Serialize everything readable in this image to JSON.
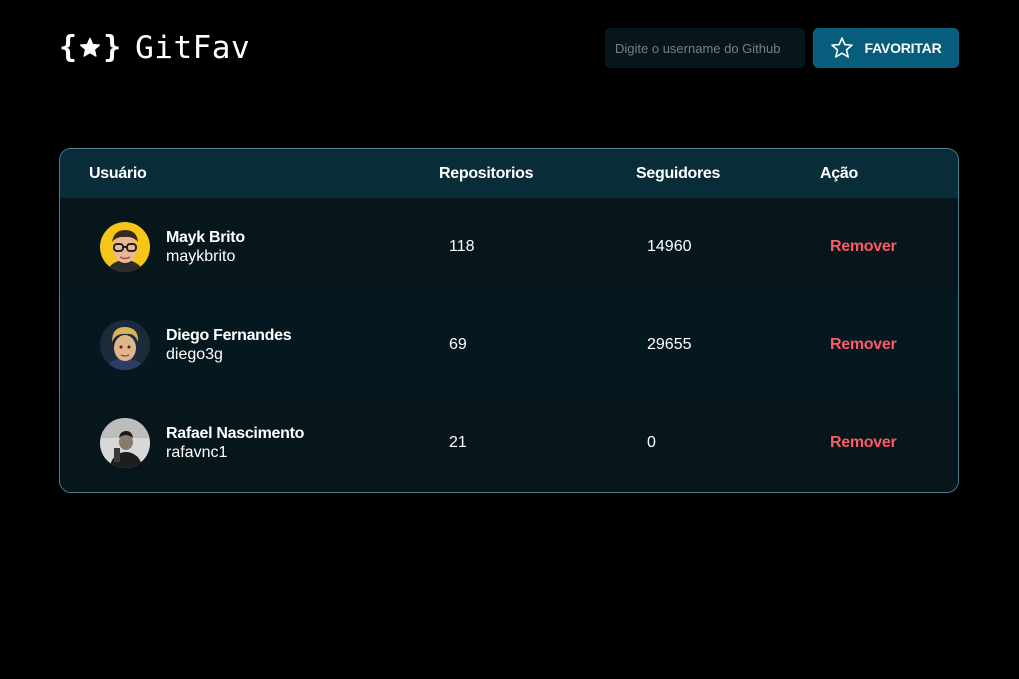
{
  "header": {
    "logo_text": "GitFav",
    "search_placeholder": "Digite o username do Github",
    "favorite_label": "FAVORITAR"
  },
  "colors": {
    "background": "#000000",
    "accent": "#065e7c",
    "table_header": "#092d38",
    "table_border": "#4a808c",
    "remove": "#f75a68"
  },
  "table": {
    "columns": [
      "Usuário",
      "Repositorios",
      "Seguidores",
      "Ação"
    ],
    "rows": [
      {
        "name": "Mayk Brito",
        "login": "maykbrito",
        "repos": "118",
        "followers": "14960",
        "action": "Remover"
      },
      {
        "name": "Diego Fernandes",
        "login": "diego3g",
        "repos": "69",
        "followers": "29655",
        "action": "Remover"
      },
      {
        "name": "Rafael Nascimento",
        "login": "rafavnc1",
        "repos": "21",
        "followers": "0",
        "action": "Remover"
      }
    ]
  }
}
